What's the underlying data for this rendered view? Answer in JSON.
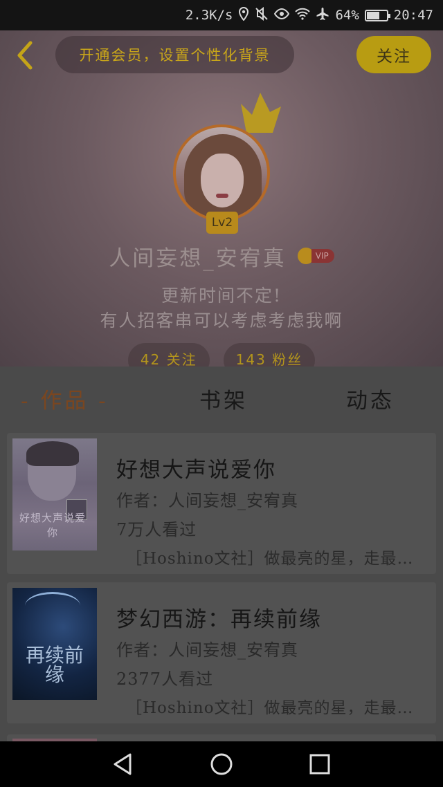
{
  "status_bar": {
    "net_speed": "2.3K/s",
    "battery": "64%",
    "battery_level": 0.64,
    "time": "20:47",
    "icons": [
      "location-icon",
      "mute-icon",
      "eye-icon",
      "wifi-icon",
      "airplane-icon",
      "battery-icon"
    ]
  },
  "header": {
    "vip_banner": "开通会员，设置个性化背景",
    "follow_label": "关注",
    "level": "Lv2",
    "username": "人间妄想_安宥真",
    "vip_badge": "VIP",
    "bio_line1": "更新时间不定!",
    "bio_line2": "有人招客串可以考虑考虑我啊",
    "following": "42 关注",
    "fans": "143 粉丝"
  },
  "tabs": [
    {
      "label": "- 作品 -",
      "active": true
    },
    {
      "label": "书架",
      "active": false
    },
    {
      "label": "动态",
      "active": false
    }
  ],
  "works": [
    {
      "title": "好想大声说爱你",
      "author": "作者：人间妄想_安宥真",
      "views": "7万人看过",
      "tag": "［Hoshino文社］做最亮的星，走最远的路"
    },
    {
      "title": "梦幻西游：再续前缘",
      "author": "作者：人间妄想_安宥真",
      "views": "2377人看过",
      "tag": "［Hoshino文社］做最亮的星，走最远的路",
      "cover_text": "再续前缘"
    }
  ],
  "colors": {
    "accent": "#b89c12",
    "active_tab": "#7a4620",
    "avatar_ring": "#b56a28"
  }
}
